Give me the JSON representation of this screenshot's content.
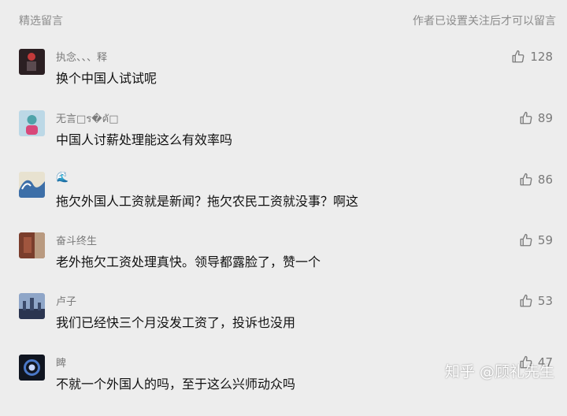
{
  "header": {
    "title": "精选留言",
    "note": "作者已设置关注后才可以留言"
  },
  "comments": [
    {
      "nick": "执念、、、释",
      "text": "换个中国人试试呢",
      "likes": "128",
      "avatar_color": "#2b1f22"
    },
    {
      "nick": "无言□ร�ฅั□",
      "text": "中国人讨薪处理能这么有效率吗",
      "likes": "89",
      "avatar_color": "#4ea3a9"
    },
    {
      "nick": "🌊",
      "text": "拖欠外国人工资就是新闻？拖欠农民工资就没事？啊这",
      "likes": "86",
      "avatar_color": "#3d6fa8"
    },
    {
      "nick": "奋斗终生",
      "text": "老外拖欠工资处理真快。领导都露脸了，赞一个",
      "likes": "59",
      "avatar_color": "#7a3d2c"
    },
    {
      "nick": "卢子",
      "text": "我们已经快三个月没发工资了，投诉也没用",
      "likes": "53",
      "avatar_color": "#3b4a6a"
    },
    {
      "nick": "睥",
      "text": "不就一个外国人的吗，至于这么兴师动众吗",
      "likes": "47",
      "avatar_color": "#101520"
    }
  ],
  "watermark": "知乎 @顾礼先生",
  "colors": {
    "background": "#ededed",
    "meta_text": "#7a7a7a",
    "body_text": "#111111"
  },
  "icons": {
    "like": "thumbs-up-icon"
  }
}
